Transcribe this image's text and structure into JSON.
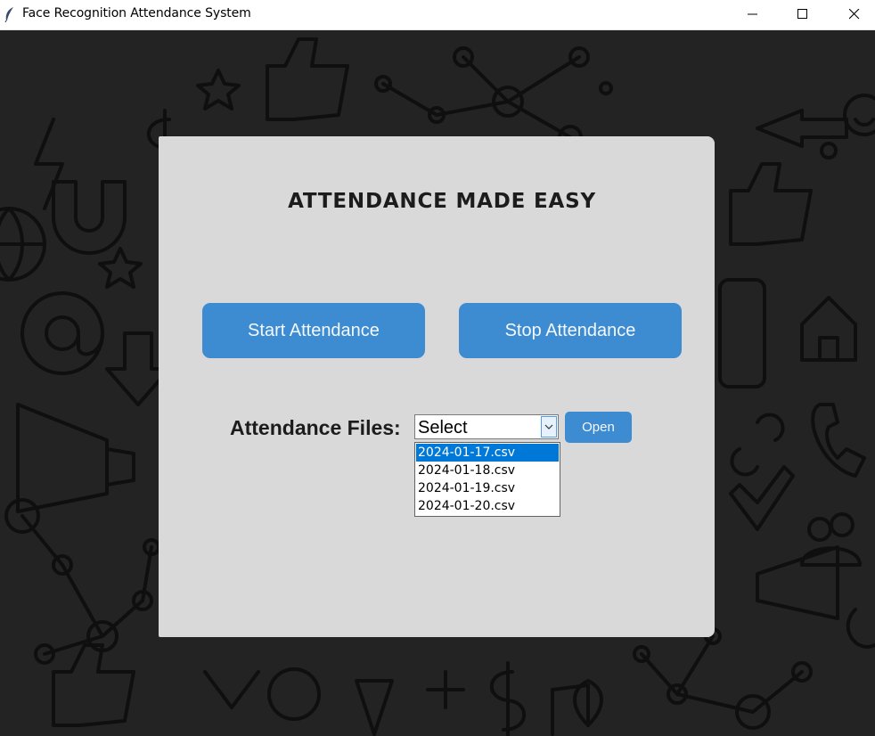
{
  "window": {
    "title": "Face Recognition Attendance System",
    "icon": "feather-icon",
    "controls": [
      "minimize-icon",
      "maximize-icon",
      "close-icon"
    ]
  },
  "panel": {
    "heading": "ATTENDANCE MADE EASY",
    "start_button": "Start Attendance",
    "stop_button": "Stop Attendance",
    "files_label": "Attendance Files:",
    "combo_value": "Select",
    "open_button": "Open"
  },
  "dropdown": {
    "options": [
      "2024-01-17.csv",
      "2024-01-18.csv",
      "2024-01-19.csv",
      "2024-01-20.csv"
    ],
    "selected_index": 0
  },
  "colors": {
    "button": "#3d8bd0",
    "panel": "#d9d9d9",
    "background": "#232323",
    "selection": "#0078d7"
  }
}
